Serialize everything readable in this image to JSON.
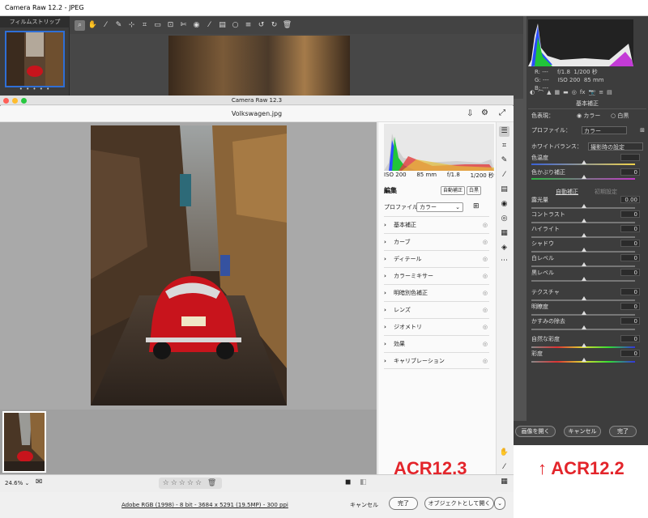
{
  "old_window": {
    "title": "Camera Raw 12.2  -  JPEG",
    "filmstrip_title": "フィルムストリップ",
    "film_dots": "• • • • •",
    "toolbar_icons": [
      "zoom-icon",
      "hand-icon",
      "eyedropper-icon",
      "color-sampler-icon",
      "target-adjust-icon",
      "crop-icon",
      "straighten-icon",
      "transform-icon",
      "spot-removal-icon",
      "redeye-icon",
      "brush-icon",
      "graduated-filter-icon",
      "radial-filter-icon",
      "preferences-icon",
      "rotate-left-icon",
      "rotate-right-icon",
      "trash-icon"
    ],
    "histogram_info": {
      "r": "R:",
      "g": "G:",
      "b": "B:",
      "dash": "---",
      "aperture": "f/1.8",
      "shutter": "1/200 秒",
      "iso": "ISO 200",
      "focal": "85 mm"
    },
    "panel_title": "基本補正",
    "treatment_label": "色表現：",
    "treatment_color": "カラー",
    "treatment_bw": "白黒",
    "profile_label": "プロファイル：",
    "profile_value": "カラー",
    "wb_label": "ホワイトバランス：",
    "wb_value": "撮影時の設定",
    "auto_label": "自動補正",
    "default_label": "初期設定",
    "sliders": [
      {
        "label": "色温度",
        "value": ""
      },
      {
        "label": "色かぶり補正",
        "value": "0"
      },
      {
        "label": "露光量",
        "value": "0.00"
      },
      {
        "label": "コントラスト",
        "value": "0"
      },
      {
        "label": "ハイライト",
        "value": "0"
      },
      {
        "label": "シャドウ",
        "value": "0"
      },
      {
        "label": "白レベル",
        "value": "0"
      },
      {
        "label": "黒レベル",
        "value": "0"
      },
      {
        "label": "テクスチャ",
        "value": "0"
      },
      {
        "label": "明瞭度",
        "value": "0"
      },
      {
        "label": "かすみの除去",
        "value": "0"
      },
      {
        "label": "自然な彩度",
        "value": "0"
      },
      {
        "label": "彩度",
        "value": "0"
      }
    ],
    "open_image": "画像を開く",
    "cancel": "キャンセル",
    "done": "完了"
  },
  "new_window": {
    "title": "Camera Raw 12.3",
    "filename": "Volkswagen.jpg",
    "histogram_info": {
      "iso": "ISO 200",
      "focal": "85 mm",
      "aperture": "f/1.8",
      "shutter": "1/200 秒"
    },
    "edit_label": "編集",
    "auto_button": "自動補正",
    "bw_button": "白黒",
    "profile_label": "プロファイル",
    "profile_value": "カラー",
    "sections": [
      "基本補正",
      "カーブ",
      "ディテール",
      "カラーミキサー",
      "明暗別色補正",
      "レンズ",
      "ジオメトリ",
      "効果",
      "キャリブレーション"
    ],
    "zoom": "24.6%",
    "stars": "☆☆☆☆☆",
    "file_info": "Adobe RGB (1998) - 8 bit - 3684 x 5291 (19.5MP) - 300 ppi",
    "cancel": "キャンセル",
    "done": "完了",
    "open_as_object": "オブジェクトとして開く"
  },
  "labels": {
    "new_version": "ACR12.3",
    "old_version": "↑ ACR12.2"
  },
  "colors": {
    "accent_red": "#e3252b",
    "selection_blue": "#2f6fd6",
    "car_red": "#c8141c"
  }
}
